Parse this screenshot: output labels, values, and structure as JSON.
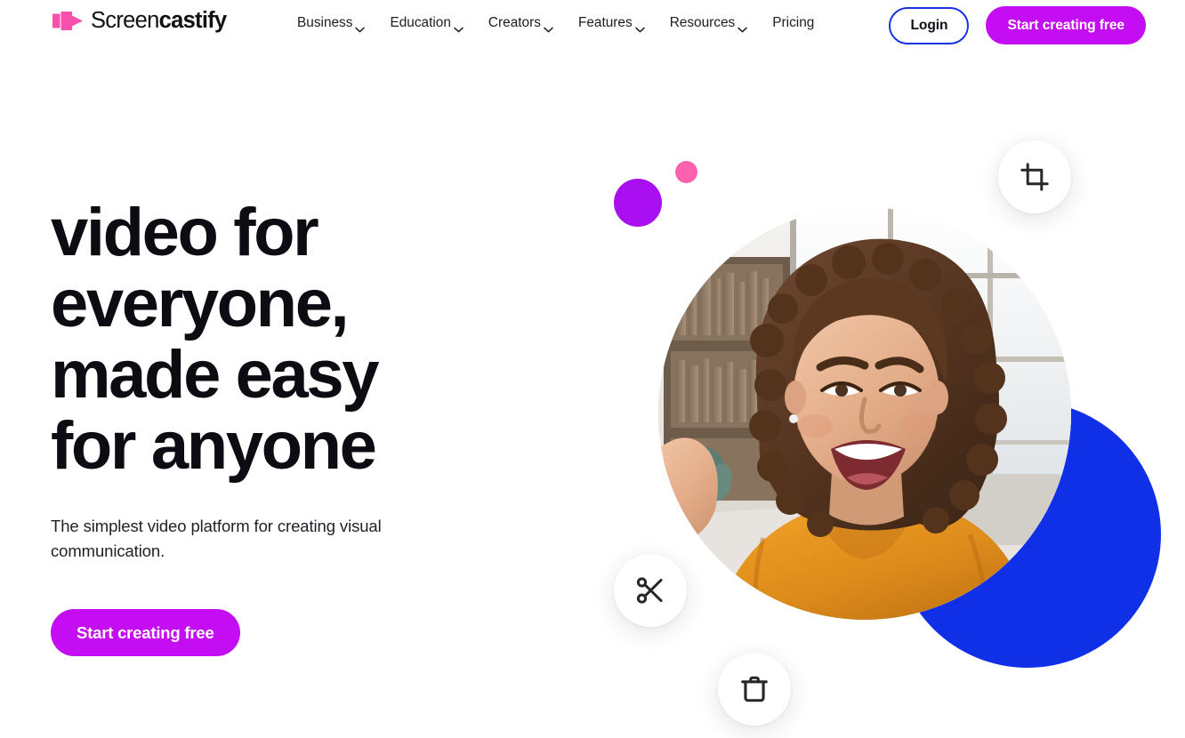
{
  "brand": {
    "name_light": "Screen",
    "name_bold": "castify",
    "logo_icon": "play-camera-mark",
    "logo_color": "#f950ae",
    "accent_magenta": "#c40df2",
    "accent_blue": "#1030e8",
    "accent_purple": "#aa0ff2",
    "accent_pink": "#fc62ad",
    "text_color": "#0c0c12",
    "background": "#ffffff"
  },
  "header": {
    "nav": [
      {
        "label": "Business",
        "has_dropdown": true,
        "icon": "chevron-down-icon"
      },
      {
        "label": "Education",
        "has_dropdown": true,
        "icon": "chevron-down-icon"
      },
      {
        "label": "Creators",
        "has_dropdown": true,
        "icon": "chevron-down-icon"
      },
      {
        "label": "Features",
        "has_dropdown": true,
        "icon": "chevron-down-icon"
      },
      {
        "label": "Resources",
        "has_dropdown": true,
        "icon": "chevron-down-icon"
      },
      {
        "label": "Pricing",
        "has_dropdown": false,
        "icon": ""
      }
    ],
    "login_label": "Login",
    "cta_label": "Start creating free"
  },
  "hero": {
    "headline": "video for everyone, made easy for anyone",
    "headline_lines": [
      "video for",
      "everyone,",
      "made easy",
      "for anyone"
    ],
    "subheading": "The simplest video platform for creating visual communication.",
    "cta_label": "Start creating free",
    "portrait_alt": "Smiling woman with curly brown hair wearing an orange hoodie in a bright room with bookshelves",
    "tool_badges": [
      {
        "name": "crop-icon",
        "label": "Crop"
      },
      {
        "name": "cut-icon",
        "label": "Cut"
      },
      {
        "name": "trash-icon",
        "label": "Delete"
      }
    ],
    "decorations": [
      {
        "name": "purple-dot",
        "color": "#aa0ff2"
      },
      {
        "name": "pink-dot",
        "color": "#fc62ad"
      },
      {
        "name": "blue-blob",
        "color": "#1030e8"
      }
    ]
  }
}
